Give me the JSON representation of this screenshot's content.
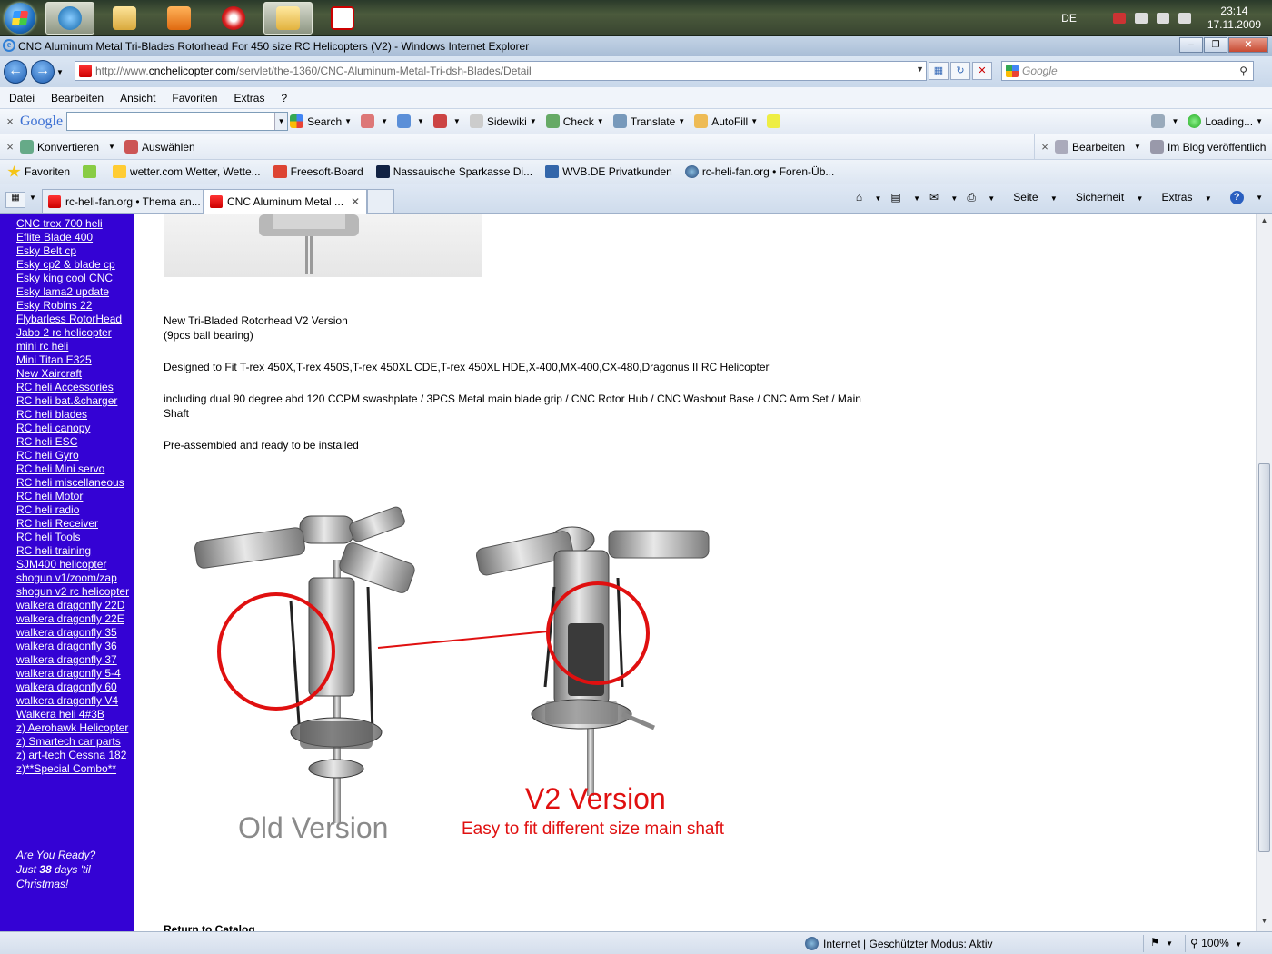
{
  "taskbar": {
    "language": "DE",
    "time": "23:14",
    "date": "17.11.2009"
  },
  "window": {
    "title": "CNC Aluminum Metal Tri-Blades Rotorhead For 450 size RC Helicopters (V2) - Windows Internet Explorer"
  },
  "address_bar": {
    "url_prefix": "http://www.",
    "url_domain": "cnchelicopter.com",
    "url_path": "/servlet/the-1360/CNC-Aluminum-Metal-Tri-dsh-Blades/Detail",
    "search_placeholder": "Google"
  },
  "menu": {
    "items": [
      "Datei",
      "Bearbeiten",
      "Ansicht",
      "Favoriten",
      "Extras",
      "?"
    ]
  },
  "google_toolbar": {
    "logo": "Google",
    "search": "Search",
    "sidewiki": "Sidewiki",
    "check": "Check",
    "translate": "Translate",
    "autofill": "AutoFill",
    "loading": "Loading..."
  },
  "convert_toolbar": {
    "convert": "Konvertieren",
    "select": "Auswählen",
    "edit": "Bearbeiten",
    "blog": "Im Blog veröffentlich"
  },
  "favorites_bar": {
    "label": "Favoriten",
    "items": [
      "wetter.com Wetter, Wette...",
      "Freesoft-Board",
      "Nassauische Sparkasse Di...",
      "WVB.DE Privatkunden",
      "rc-heli-fan.org • Foren-Üb..."
    ]
  },
  "tabs": [
    {
      "label": "rc-heli-fan.org • Thema an..."
    },
    {
      "label": "CNC Aluminum Metal ..."
    }
  ],
  "command_bar": {
    "page": "Seite",
    "security": "Sicherheit",
    "extras": "Extras"
  },
  "sidebar": {
    "links": [
      "CNC trex 700 heli",
      "Eflite Blade 400",
      "Esky Belt cp",
      "Esky cp2 & blade cp",
      "Esky king cool CNC",
      "Esky lama2 update",
      "Esky Robins 22",
      "Flybarless RotorHead",
      "Jabo 2 rc helicopter",
      "mini rc heli",
      "Mini Titan E325",
      "New Xaircraft",
      "RC heli Accessories",
      "RC heli bat.&charger",
      "RC heli blades",
      "RC heli canopy",
      "RC heli ESC",
      "RC heli Gyro",
      "RC heli Mini servo",
      "RC heli miscellaneous",
      "RC heli Motor",
      "RC heli radio",
      "RC heli Receiver",
      "RC heli Tools",
      "RC heli training",
      "SJM400 helicopter",
      "shogun v1/zoom/zap",
      "shogun v2 rc helicopter",
      "walkera dragonfly 22D",
      "walkera dragonfly 22E",
      "walkera dragonfly 35",
      "walkera dragonfly 36",
      "walkera dragonfly 37",
      "walkera dragonfly 5-4",
      "walkera dragonfly 60",
      "walkera dragonfly V4",
      "Walkera heli 4#3B",
      "z) Aerohawk Helicopter",
      "z) Smartech car parts",
      "z) art-tech Cessna 182",
      "z)**Special Combo**"
    ],
    "countdown_line1": "Are You Ready?",
    "countdown_just": "Just ",
    "countdown_days": "38",
    "countdown_line2_rest": " days 'til",
    "countdown_line3": "Christmas!"
  },
  "main": {
    "line1": "New Tri-Bladed Rotorhead V2 Version",
    "line2": "(9pcs ball bearing)",
    "designed": "Designed to Fit T-rex 450X,T-rex 450S,T-rex 450XL CDE,T-rex 450XL HDE,X-400,MX-400,CX-480,Dragonus II RC Helicopter",
    "including": "including dual 90 degree abd 120 CCPM swashplate / 3PCS Metal main blade grip / CNC Rotor Hub / CNC Washout Base / CNC Arm Set / Main Shaft",
    "preassembled": "Pre-assembled and ready to be installed",
    "return": "Return to Catalog"
  },
  "product_image": {
    "old_label": "Old Version",
    "new_label": "V2 Version",
    "new_sub": "Easy to fit different size main shaft",
    "old_color": "#8a8a8a",
    "new_color": "#e01010"
  },
  "status_bar": {
    "zone": "Internet | Geschützter Modus: Aktiv",
    "zoom": "100%"
  }
}
